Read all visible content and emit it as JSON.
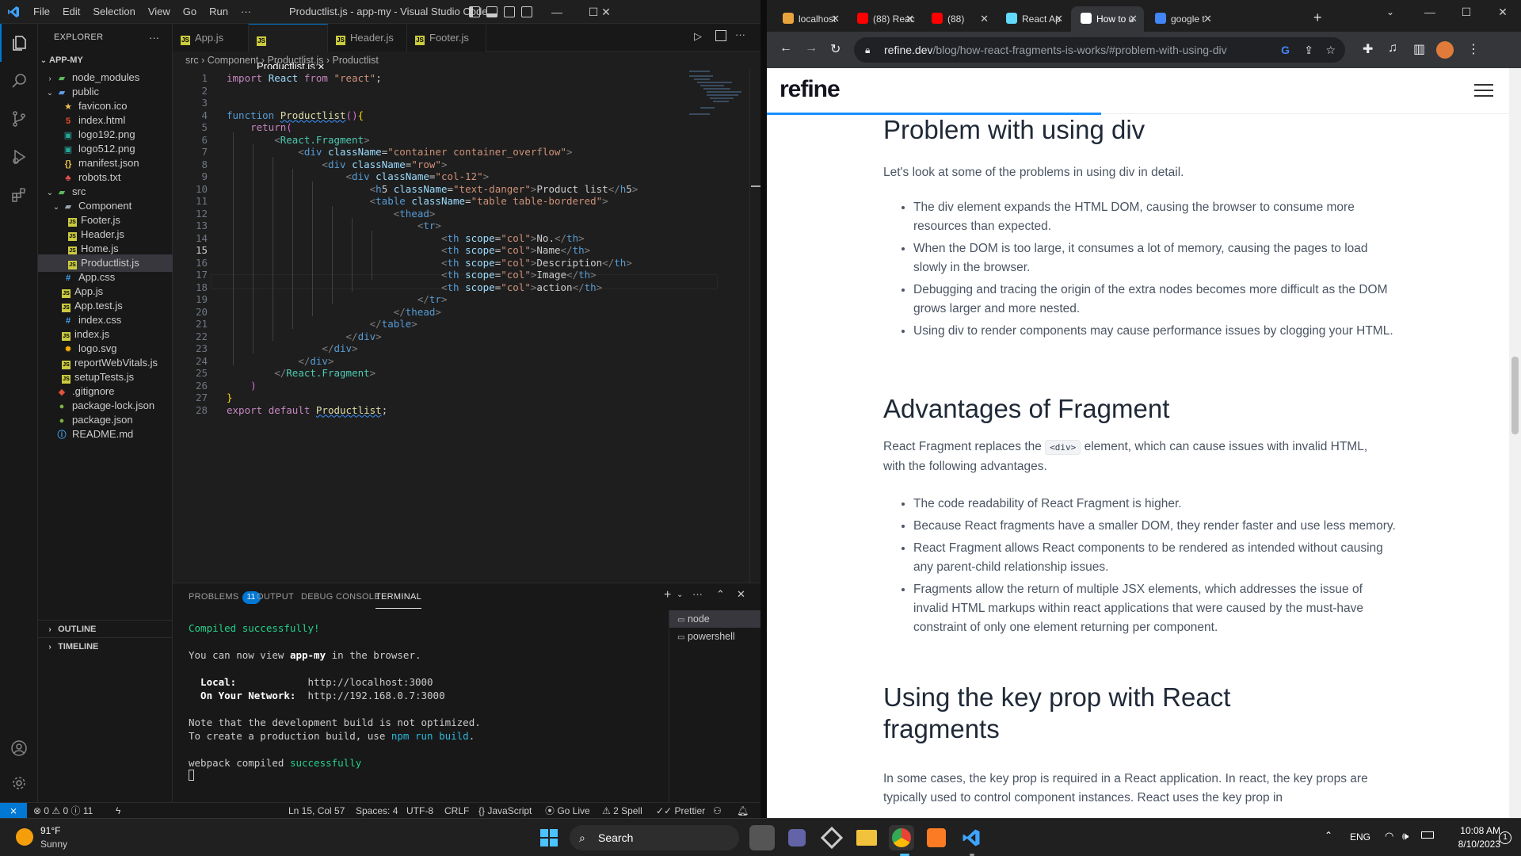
{
  "vscode": {
    "menu": [
      "File",
      "Edit",
      "Selection",
      "View",
      "Go",
      "Run",
      "···"
    ],
    "window_title": "Productlist.js - app-my - Visual Studio Code",
    "explorer_title": "EXPLORER",
    "project": "APP-MY",
    "tree": [
      {
        "label": "node_modules",
        "icon": "folder-green-icon",
        "depth": 1,
        "type": "folder-closed"
      },
      {
        "label": "public",
        "icon": "folder-blue-icon",
        "depth": 1,
        "type": "folder-open"
      },
      {
        "label": "favicon.ico",
        "icon": "star-icon",
        "depth": 2,
        "type": "file"
      },
      {
        "label": "index.html",
        "icon": "html-icon",
        "depth": 2,
        "type": "file"
      },
      {
        "label": "logo192.png",
        "icon": "image-icon",
        "depth": 2,
        "type": "file"
      },
      {
        "label": "logo512.png",
        "icon": "image-icon",
        "depth": 2,
        "type": "file"
      },
      {
        "label": "manifest.json",
        "icon": "json-icon",
        "depth": 2,
        "type": "file"
      },
      {
        "label": "robots.txt",
        "icon": "robot-icon",
        "depth": 2,
        "type": "file"
      },
      {
        "label": "src",
        "icon": "folder-green-icon",
        "depth": 1,
        "type": "folder-open"
      },
      {
        "label": "Component",
        "icon": "folder-icon",
        "depth": 2,
        "type": "folder-open"
      },
      {
        "label": "Footer.js",
        "icon": "js-icon",
        "depth": 3,
        "type": "file"
      },
      {
        "label": "Header.js",
        "icon": "js-icon",
        "depth": 3,
        "type": "file"
      },
      {
        "label": "Home.js",
        "icon": "js-icon",
        "depth": 3,
        "type": "file"
      },
      {
        "label": "Productlist.js",
        "icon": "js-icon",
        "depth": 3,
        "type": "file",
        "selected": true
      },
      {
        "label": "App.css",
        "icon": "css-icon",
        "depth": 2,
        "type": "file"
      },
      {
        "label": "App.js",
        "icon": "js-icon",
        "depth": 2,
        "type": "file"
      },
      {
        "label": "App.test.js",
        "icon": "js-icon",
        "depth": 2,
        "type": "file"
      },
      {
        "label": "index.css",
        "icon": "css-icon",
        "depth": 2,
        "type": "file"
      },
      {
        "label": "index.js",
        "icon": "js-icon",
        "depth": 2,
        "type": "file"
      },
      {
        "label": "logo.svg",
        "icon": "svg-icon",
        "depth": 2,
        "type": "file"
      },
      {
        "label": "reportWebVitals.js",
        "icon": "js-icon",
        "depth": 2,
        "type": "file"
      },
      {
        "label": "setupTests.js",
        "icon": "js-icon",
        "depth": 2,
        "type": "file"
      },
      {
        "label": ".gitignore",
        "icon": "git-icon",
        "depth": 1,
        "type": "file"
      },
      {
        "label": "package-lock.json",
        "icon": "npm-icon",
        "depth": 1,
        "type": "file"
      },
      {
        "label": "package.json",
        "icon": "npm-icon",
        "depth": 1,
        "type": "file"
      },
      {
        "label": "README.md",
        "icon": "info-icon",
        "depth": 1,
        "type": "file"
      }
    ],
    "outline": "OUTLINE",
    "timeline": "TIMELINE",
    "tabs": [
      "App.js",
      "Productlist.js",
      "Header.js",
      "Footer.js"
    ],
    "active_tab": "Productlist.js",
    "breadcrumb": [
      "src",
      "Component",
      "Productlist.js",
      "Productlist"
    ],
    "code": [
      "import React from \"react\";",
      "",
      "",
      "function Productlist(){",
      "    return(",
      "        <React.Fragment>",
      "            <div className=\"container container_overflow\">",
      "                <div className=\"row\">",
      "                    <div className=\"col-12\">",
      "                        <h5 className=\"text-danger\">Product list</h5>",
      "                        <table className=\"table table-bordered\">",
      "                            <thead>",
      "                                <tr>",
      "                                    <th scope=\"col\">No.</th>",
      "                                    <th scope=\"col\">Name</th>",
      "                                    <th scope=\"col\">Description</th>",
      "                                    <th scope=\"col\">Image</th>",
      "                                    <th scope=\"col\">action</th>",
      "                                </tr>",
      "                            </thead>",
      "                        </table>",
      "                    </div>",
      "                </div>",
      "            </div>",
      "        </React.Fragment>",
      "    )",
      "}",
      "export default Productlist;"
    ],
    "current_line": 15,
    "panel_tabs": [
      "PROBLEMS",
      "OUTPUT",
      "DEBUG CONSOLE",
      "TERMINAL"
    ],
    "problems_count": "11",
    "terminal": {
      "compiled": "Compiled successfully!",
      "view_pre": "You can now view ",
      "app": "app-my",
      "view_post": " in the browser.",
      "local_label": "  Local:            ",
      "local_url": "http://localhost:3000",
      "net_label": "  On Your Network:  ",
      "net_url": "http://192.168.0.7:3000",
      "note1": "Note that the development build is not optimized.",
      "note2_pre": "To create a production build, use ",
      "note2_cmd": "npm run build",
      "note2_post": ".",
      "webpack_pre": "webpack compiled ",
      "webpack_ok": "successfully"
    },
    "terminals": [
      "node",
      "powershell"
    ],
    "status": {
      "errors": "0",
      "warnings": "0",
      "info": "11",
      "position": "Ln 15, Col 57",
      "spaces": "Spaces: 4",
      "encoding": "UTF-8",
      "eol": "CRLF",
      "language": "JavaScript",
      "golive": "Go Live",
      "spell": "2 Spell",
      "prettier": "Prettier"
    }
  },
  "chrome": {
    "tabs": [
      {
        "label": "localhost",
        "color": "#e8a33d"
      },
      {
        "label": "(88) Reac",
        "color": "#ff0000"
      },
      {
        "label": "(88)",
        "color": "#ff0000"
      },
      {
        "label": "React Ap",
        "color": "#61dafb"
      },
      {
        "label": "How to u",
        "color": "#ffffff"
      },
      {
        "label": "google t",
        "color": "#4285f4"
      }
    ],
    "active_tab": 4,
    "url_host": "refine.dev",
    "url_path": "/blog/how-react-fragments-is-works/#problem-with-using-div"
  },
  "article": {
    "logo": "refine",
    "reading_progress": 0.45,
    "h_problem": "Problem with using div",
    "p_problem": "Let's look at some of the problems in using div in detail.",
    "problems": [
      "The div element expands the HTML DOM, causing the browser to consume more resources than expected.",
      "When the DOM is too large, it consumes a lot of memory, causing the pages to load slowly in the browser.",
      "Debugging and tracing the origin of the extra nodes becomes more difficult as the DOM grows larger and more nested.",
      "Using div to render components may cause performance issues by clogging your HTML."
    ],
    "h_adv": "Advantages of Fragment",
    "p_adv_pre": "React Fragment replaces the ",
    "p_adv_code": "<div>",
    "p_adv_post": " element, which can cause issues with invalid HTML, with the following advantages.",
    "advantages": [
      "The code readability of React Fragment is higher.",
      "Because React fragments have a smaller DOM, they render faster and use less memory.",
      "React Fragment allows React components to be rendered as intended without causing any parent-child relationship issues.",
      "Fragments allow the return of multiple JSX elements, which addresses the issue of invalid HTML markups within react applications that were caused by the must-have constraint of only one element returning per component."
    ],
    "h_key": "Using the key prop with React fragments",
    "p_key": "In some cases, the key prop is required in a React application. In react, the key props are typically used to control component instances. React uses the key prop in"
  },
  "taskbar": {
    "temp": "91°F",
    "weather": "Sunny",
    "search": "Search",
    "lang": "ENG",
    "time": "10:08 AM",
    "date": "8/10/2023",
    "notif": "1"
  }
}
